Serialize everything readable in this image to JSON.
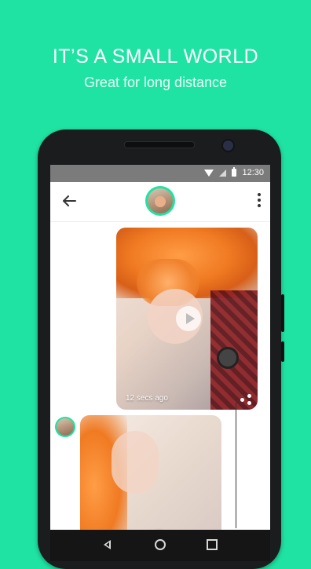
{
  "promo": {
    "headline": "IT’S A SMALL WORLD",
    "subline": "Great for long distance"
  },
  "status_bar": {
    "time": "12:30"
  },
  "chat": {
    "messages": [
      {
        "type": "video",
        "timestamp": "12 secs ago",
        "sender": "me"
      },
      {
        "type": "video",
        "sender": "contact"
      }
    ]
  },
  "icons": {
    "back": "arrow-left-icon",
    "menu": "more-vertical-icon",
    "play": "play-icon",
    "share": "share-icon",
    "notes": "notes-icon",
    "record": "record-button",
    "chevron": "chevron-up-icon",
    "image": "image-icon",
    "nav_back": "nav-back-icon",
    "nav_home": "nav-home-icon",
    "nav_recent": "nav-recent-icon"
  },
  "colors": {
    "background": "#1fe3a3",
    "accent": "#2f8ff5",
    "status_bar": "#7b7b7b"
  }
}
